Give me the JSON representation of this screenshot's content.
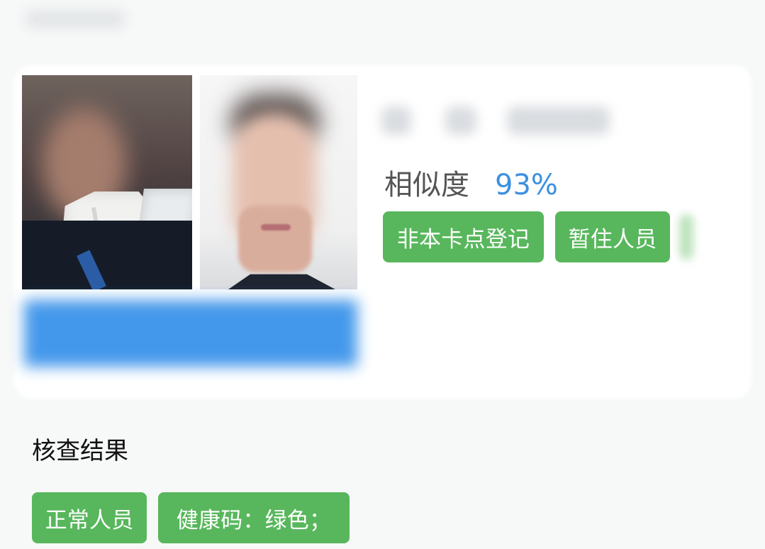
{
  "similarity": {
    "label": "相似度",
    "value": "93%"
  },
  "tags_top": [
    "非本卡点登记",
    "暂住人员"
  ],
  "section": {
    "title": "核查结果"
  },
  "tags_bottom": [
    "正常人员",
    "健康码：绿色；"
  ],
  "colors": {
    "accent_blue": "#3C90E0",
    "tag_green": "#58B75C",
    "blue_blur": "#3B93EA"
  }
}
